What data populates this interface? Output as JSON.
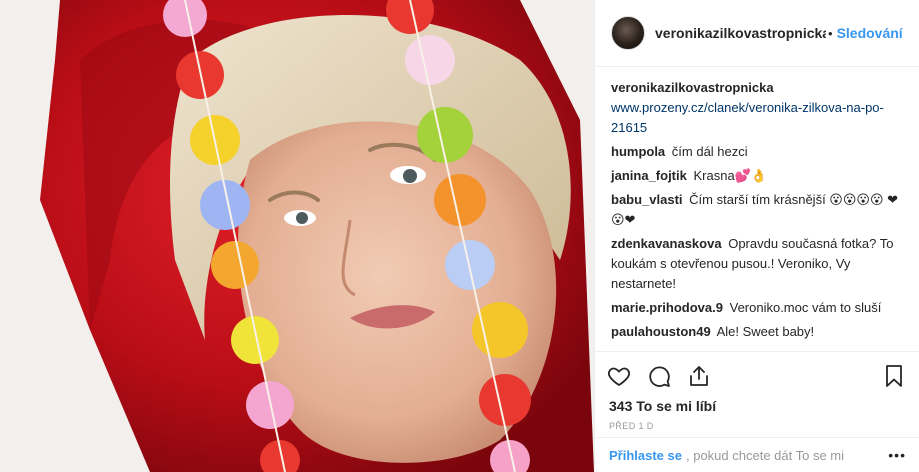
{
  "header": {
    "username": "veronikazilkovastropnicka",
    "separator": "•",
    "follow_label": "Sledování"
  },
  "caption": {
    "username": "veronikazilkovastropnicka",
    "text": "www.prozeny.cz/clanek/veronika-zilkova-na-po-21615"
  },
  "comments": [
    {
      "user": "humpola",
      "text": "čím dál hezci"
    },
    {
      "user": "janina_fojtik",
      "text": "Krasna💕👌"
    },
    {
      "user": "babu_vlasti",
      "text": "Čím starší tím krásnější 😮😮😮😮 ❤😮❤"
    },
    {
      "user": "zdenkavanaskova",
      "text": "Opravdu současná fotka? To koukám s otevřenou pusou.! Veroniko, Vy nestarnete!"
    },
    {
      "user": "marie.prihodova.9",
      "text": "Veroniko.moc vám to sluší"
    },
    {
      "user": "paulahouston49",
      "text": "Ale! Sweet baby!"
    }
  ],
  "likes_text": "343 To se mi líbí",
  "date_text": "PŘED 1 D",
  "footer": {
    "login_label": "Přihlaste se",
    "rest_text": ", pokud chcete dát To se mi",
    "more_label": "•••"
  },
  "icons": [
    "heart-icon",
    "comment-icon",
    "share-icon",
    "bookmark-icon",
    "more-icon"
  ],
  "colors": {
    "link": "#3897f0",
    "text": "#262626",
    "muted": "#999999",
    "hood": "#c8101a"
  }
}
